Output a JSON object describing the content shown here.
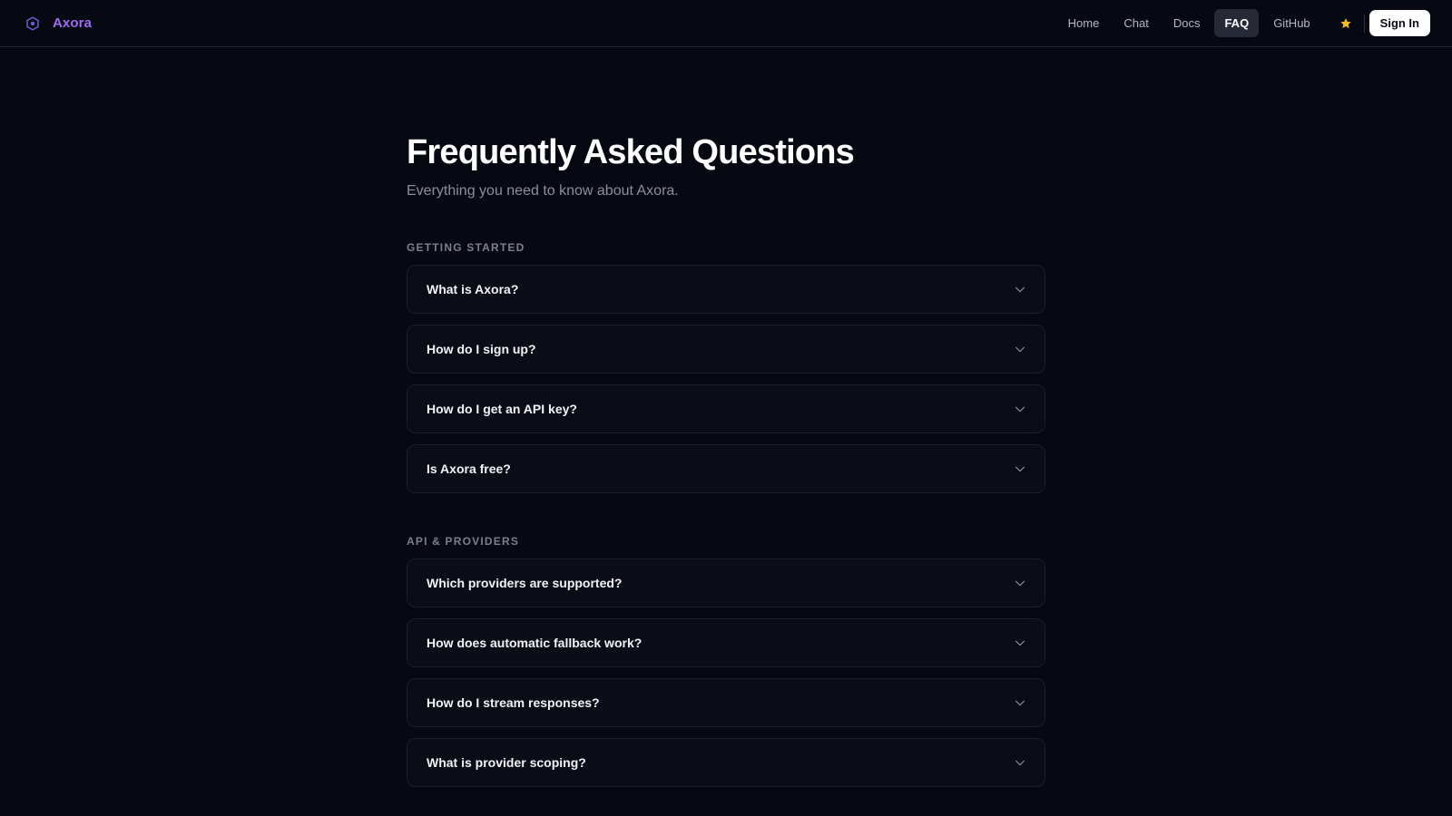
{
  "header": {
    "brand": "Axora",
    "nav": [
      {
        "label": "Home",
        "active": false
      },
      {
        "label": "Chat",
        "active": false
      },
      {
        "label": "Docs",
        "active": false
      },
      {
        "label": "FAQ",
        "active": true
      },
      {
        "label": "GitHub",
        "active": false
      }
    ],
    "star_icon": "star-icon",
    "sign_in": "Sign In"
  },
  "page": {
    "title": "Frequently Asked Questions",
    "subtitle": "Everything you need to know about Axora."
  },
  "sections": [
    {
      "label": "Getting Started",
      "questions": [
        "What is Axora?",
        "How do I sign up?",
        "How do I get an API key?",
        "Is Axora free?"
      ]
    },
    {
      "label": "API & Providers",
      "questions": [
        "Which providers are supported?",
        "How does automatic fallback work?",
        "How do I stream responses?",
        "What is provider scoping?"
      ]
    }
  ],
  "colors": {
    "background": "#070912",
    "brand": "#a06bf5",
    "star": "#f5b829",
    "card": "#0a0d16",
    "card_border": "#1c202a"
  }
}
